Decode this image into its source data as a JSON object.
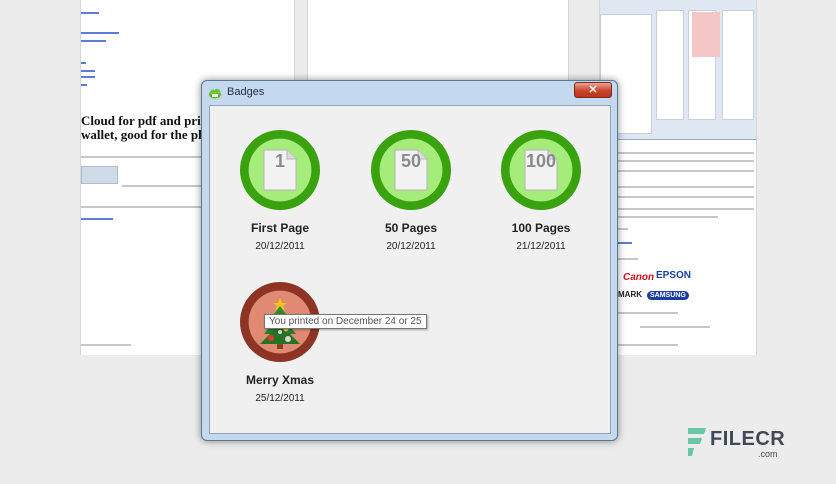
{
  "background_page": {
    "heading_line1": "Cloud for pdf and printer",
    "heading_line2": "wallet, good for the planet",
    "right_brands": [
      "Canon",
      "EPSON",
      "SAMSUNG",
      "MARK"
    ]
  },
  "dialog": {
    "title": "Badges",
    "close_label": "✕"
  },
  "badges": [
    {
      "number": "1",
      "name": "First Page",
      "date": "20/12/2011",
      "style": "green"
    },
    {
      "number": "50",
      "name": "50 Pages",
      "date": "20/12/2011",
      "style": "green"
    },
    {
      "number": "100",
      "name": "100 Pages",
      "date": "21/12/2011",
      "style": "green"
    },
    {
      "number": "",
      "name": "Merry Xmas",
      "date": "25/12/2011",
      "style": "red"
    }
  ],
  "tooltip": "You printed on December 24 or 25",
  "watermark": {
    "name": "FILECR",
    "suffix": ".com"
  },
  "colors": {
    "medal_green": "#3aa20e",
    "medal_red": "#8e3424",
    "title_bar": "#c5d9ee"
  }
}
